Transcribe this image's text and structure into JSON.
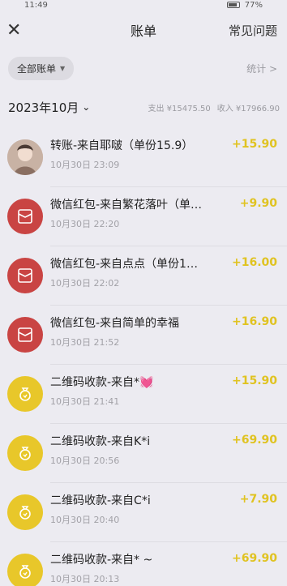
{
  "status": {
    "time": "11:49",
    "battery": "77%"
  },
  "nav": {
    "title": "账单",
    "faq": "常见问题"
  },
  "filter": {
    "pill_label": "全部账单",
    "stats_label": "统计 >"
  },
  "month": {
    "label": "2023年10月",
    "expense": "支出 ¥15475.50",
    "income": "收入 ¥17966.90"
  },
  "transactions": [
    {
      "title": "转账-来自耶啵（单份15.9）",
      "time": "10月30日 23:09",
      "amount": "+15.90",
      "icon": "avatar"
    },
    {
      "title": "微信红包-来自繁花落叶（单…",
      "time": "10月30日 22:20",
      "amount": "+9.90",
      "icon": "red-envelope-icon"
    },
    {
      "title": "微信红包-来自点点（单份1…",
      "time": "10月30日 22:02",
      "amount": "+16.00",
      "icon": "red-envelope-icon"
    },
    {
      "title": "微信红包-来自简单的幸福",
      "time": "10月30日 21:52",
      "amount": "+16.90",
      "icon": "red-envelope-icon"
    },
    {
      "title": "二维码收款-来自*💓",
      "time": "10月30日 21:41",
      "amount": "+15.90",
      "icon": "money-bag-icon"
    },
    {
      "title": "二维码收款-来自K*i",
      "time": "10月30日 20:56",
      "amount": "+69.90",
      "icon": "money-bag-icon"
    },
    {
      "title": "二维码收款-来自C*i",
      "time": "10月30日 20:40",
      "amount": "+7.90",
      "icon": "money-bag-icon"
    },
    {
      "title": "二维码收款-来自* ~",
      "time": "10月30日 20:13",
      "amount": "+69.90",
      "icon": "money-bag-icon"
    }
  ],
  "colors": {
    "income": "#e0c321",
    "red_envelope": "#c94443",
    "qr_payment": "#e8c72a",
    "background": "#ecebf1"
  }
}
